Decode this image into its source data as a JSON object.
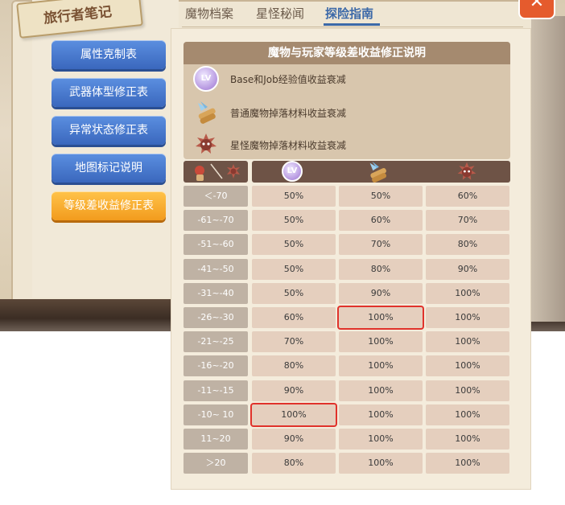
{
  "notebook": {
    "title": "旅行者笔记"
  },
  "close": {
    "label": "✕"
  },
  "tabs": [
    {
      "label": "魔物档案"
    },
    {
      "label": "星怪秘闻"
    },
    {
      "label": "探险指南"
    }
  ],
  "sidebar": {
    "items": [
      {
        "label": "属性克制表"
      },
      {
        "label": "武器体型修正表"
      },
      {
        "label": "异常状态修正表"
      },
      {
        "label": "地图标记说明"
      },
      {
        "label": "等级差收益修正表"
      }
    ]
  },
  "info": {
    "title": "魔物与玩家等级差收益修正说明",
    "rows": [
      {
        "icon": "lv-exp-icon",
        "text": "Base和Job经验值收益衰减"
      },
      {
        "icon": "material-icon",
        "text": "普通魔物掉落材料收益衰减"
      },
      {
        "icon": "star-monster-icon",
        "text": "星怪魔物掉落材料收益衰减"
      }
    ]
  },
  "table": {
    "headers": [
      "lv-exp-icon",
      "material-icon",
      "star-monster-icon"
    ],
    "rows": [
      {
        "label": "＜-70",
        "values": [
          "50%",
          "50%",
          "60%"
        ]
      },
      {
        "label": "-61~-70",
        "values": [
          "50%",
          "60%",
          "70%"
        ]
      },
      {
        "label": "-51~-60",
        "values": [
          "50%",
          "70%",
          "80%"
        ]
      },
      {
        "label": "-41~-50",
        "values": [
          "50%",
          "80%",
          "90%"
        ]
      },
      {
        "label": "-31~-40",
        "values": [
          "50%",
          "90%",
          "100%"
        ]
      },
      {
        "label": "-26~-30",
        "values": [
          "60%",
          "100%",
          "100%"
        ]
      },
      {
        "label": "-21~-25",
        "values": [
          "70%",
          "100%",
          "100%"
        ]
      },
      {
        "label": "-16~-20",
        "values": [
          "80%",
          "100%",
          "100%"
        ]
      },
      {
        "label": "-11~-15",
        "values": [
          "90%",
          "100%",
          "100%"
        ]
      },
      {
        "label": "-10~ 10",
        "values": [
          "100%",
          "100%",
          "100%"
        ]
      },
      {
        "label": "11~20",
        "values": [
          "90%",
          "100%",
          "100%"
        ]
      },
      {
        "label": "＞20",
        "values": [
          "80%",
          "100%",
          "100%"
        ]
      }
    ],
    "highlighted": [
      {
        "row": 5,
        "col": 1
      },
      {
        "row": 9,
        "col": 0
      }
    ],
    "highlight_color": "#e0322b"
  },
  "colors": {
    "accent": "#3c69a8",
    "button_blue": "#3a67bd",
    "button_orange": "#f29b1d",
    "header_brown": "#6e5346"
  }
}
